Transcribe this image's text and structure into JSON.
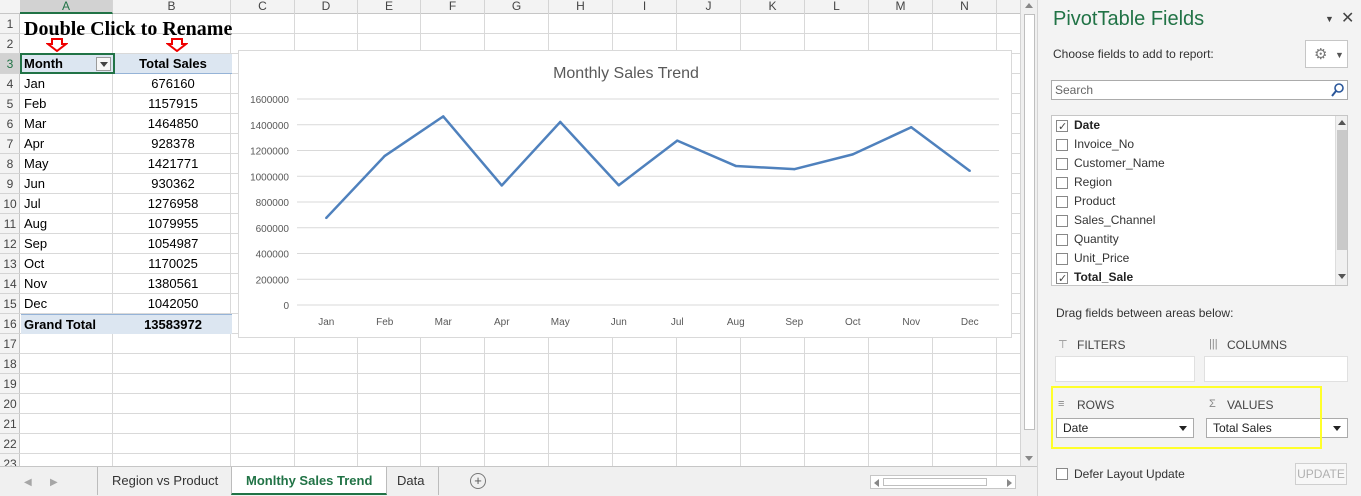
{
  "sheet": {
    "columns": [
      "A",
      "B",
      "C",
      "D",
      "E",
      "F",
      "G",
      "H",
      "I",
      "J",
      "K",
      "L",
      "M",
      "N"
    ],
    "rows": [
      "1",
      "2",
      "3",
      "4",
      "5",
      "6",
      "7",
      "8",
      "9",
      "10",
      "11",
      "12",
      "13",
      "14",
      "15",
      "16",
      "17",
      "18",
      "19",
      "20",
      "21",
      "22",
      "23"
    ],
    "title_text": "Double Click to Rename",
    "pivot": {
      "header_month": "Month",
      "header_sales": "Total Sales",
      "rows": [
        {
          "month": "Jan",
          "sales": "676160"
        },
        {
          "month": "Feb",
          "sales": "1157915"
        },
        {
          "month": "Mar",
          "sales": "1464850"
        },
        {
          "month": "Apr",
          "sales": "928378"
        },
        {
          "month": "May",
          "sales": "1421771"
        },
        {
          "month": "Jun",
          "sales": "930362"
        },
        {
          "month": "Jul",
          "sales": "1276958"
        },
        {
          "month": "Aug",
          "sales": "1079955"
        },
        {
          "month": "Sep",
          "sales": "1054987"
        },
        {
          "month": "Oct",
          "sales": "1170025"
        },
        {
          "month": "Nov",
          "sales": "1380561"
        },
        {
          "month": "Dec",
          "sales": "1042050"
        }
      ],
      "total_label": "Grand Total",
      "total_value": "13583972"
    }
  },
  "chart_data": {
    "type": "line",
    "title": "Monthly Sales Trend",
    "categories": [
      "Jan",
      "Feb",
      "Mar",
      "Apr",
      "May",
      "Jun",
      "Jul",
      "Aug",
      "Sep",
      "Oct",
      "Nov",
      "Dec"
    ],
    "series": [
      {
        "values": [
          676160,
          1157915,
          1464850,
          928378,
          1421771,
          930362,
          1276958,
          1079955,
          1054987,
          1170025,
          1380561,
          1042050
        ]
      }
    ],
    "ylim": [
      0,
      1600000
    ],
    "yticks": [
      "0",
      "200000",
      "400000",
      "600000",
      "800000",
      "1000000",
      "1200000",
      "1400000",
      "1600000"
    ],
    "grid": true,
    "legend": "none",
    "line_color": "#4f81bd"
  },
  "tabs": {
    "items": [
      "Region vs Product",
      "Monlthy Sales Trend",
      "Data"
    ],
    "active": "Monlthy Sales Trend",
    "add_symbol": "+"
  },
  "pane": {
    "title": "PivotTable Fields",
    "dropdown_glyph": "▼",
    "close_glyph": "✕",
    "choose_label": "Choose fields to add to report:",
    "gear_glyph": "⚙",
    "gear_caret": "▼",
    "search_placeholder": "Search",
    "fields": [
      {
        "label": "Date",
        "checked": true
      },
      {
        "label": "Invoice_No",
        "checked": false
      },
      {
        "label": "Customer_Name",
        "checked": false
      },
      {
        "label": "Region",
        "checked": false
      },
      {
        "label": "Product",
        "checked": false
      },
      {
        "label": "Sales_Channel",
        "checked": false
      },
      {
        "label": "Quantity",
        "checked": false
      },
      {
        "label": "Unit_Price",
        "checked": false
      },
      {
        "label": "Total_Sale",
        "checked": true
      }
    ],
    "drag_label": "Drag fields between areas below:",
    "areas": {
      "filters": "FILTERS",
      "columns": "COLUMNS",
      "rows": "ROWS",
      "values": "VALUES",
      "rows_item": "Date",
      "values_item": "Total Sales"
    },
    "area_icons": {
      "filters": "⊤",
      "columns": "|||",
      "rows": "≡",
      "values": "Σ"
    },
    "defer_label": "Defer Layout Update",
    "update_label": "UPDATE",
    "highlight_color": "#ffff2a",
    "accent_color": "#217346"
  }
}
